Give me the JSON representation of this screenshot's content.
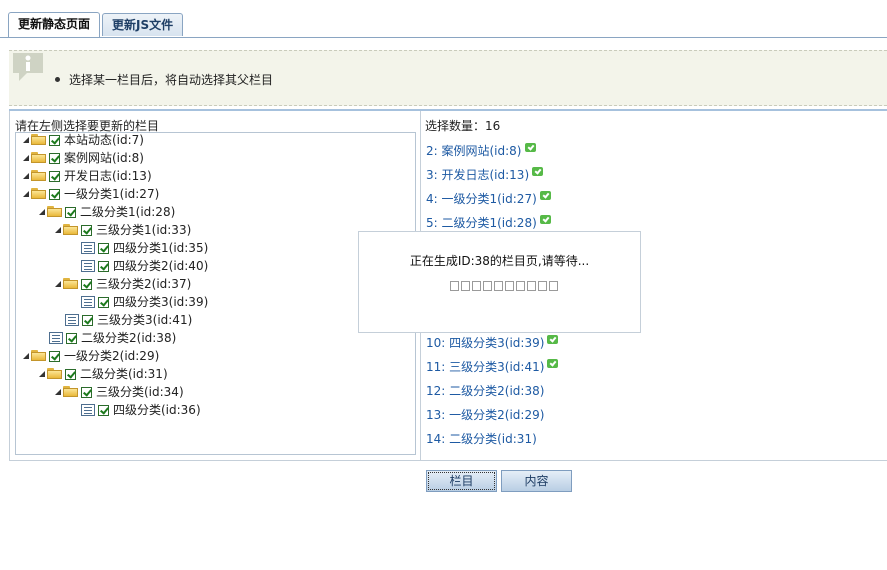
{
  "tabs": [
    {
      "label": "更新静态页面",
      "active": true
    },
    {
      "label": "更新JS文件",
      "active": false
    }
  ],
  "info": {
    "text": "选择某一栏目后，将自动选择其父栏目"
  },
  "left": {
    "title": "请在左侧选择要更新的栏目"
  },
  "tree": [
    {
      "label": "本站动态(id:7)"
    },
    {
      "label": "案例网站(id:8)"
    },
    {
      "label": "开发日志(id:13)"
    },
    {
      "label": "一级分类1(id:27)"
    },
    {
      "label": "二级分类1(id:28)"
    },
    {
      "label": "三级分类1(id:33)"
    },
    {
      "label": "四级分类1(id:35)"
    },
    {
      "label": "四级分类2(id:40)"
    },
    {
      "label": "三级分类2(id:37)"
    },
    {
      "label": "四级分类3(id:39)"
    },
    {
      "label": "三级分类3(id:41)"
    },
    {
      "label": "二级分类2(id:38)"
    },
    {
      "label": "一级分类2(id:29)"
    },
    {
      "label": "二级分类(id:31)"
    },
    {
      "label": "三级分类(id:34)"
    },
    {
      "label": "四级分类(id:36)"
    }
  ],
  "right": {
    "title": "选择数量：16",
    "items": [
      {
        "label": "2: 案例网站(id:8)",
        "done": true
      },
      {
        "label": "3: 开发日志(id:13)",
        "done": true
      },
      {
        "label": "4: 一级分类1(id:27)",
        "done": true
      },
      {
        "label": "5: 二级分类1(id:28)",
        "done": true
      },
      {
        "label": "10: 四级分类3(id:39)",
        "done": true
      },
      {
        "label": "11: 三级分类3(id:41)",
        "done": true
      },
      {
        "label": "12: 二级分类2(id:38)",
        "done": false
      },
      {
        "label": "13: 一级分类2(id:29)",
        "done": false
      },
      {
        "label": "14: 二级分类(id:31)",
        "done": false
      }
    ]
  },
  "buttons": {
    "column": "栏目",
    "content": "内容"
  },
  "modal": {
    "message": "正在生成ID:38的栏目页,请等待...",
    "progress_boxes": 10
  },
  "colors": {
    "link": "#1e5aa3",
    "tab_text": "#1f3f66",
    "info_bg": "#f3f4ea",
    "ok_green": "#56b947"
  }
}
